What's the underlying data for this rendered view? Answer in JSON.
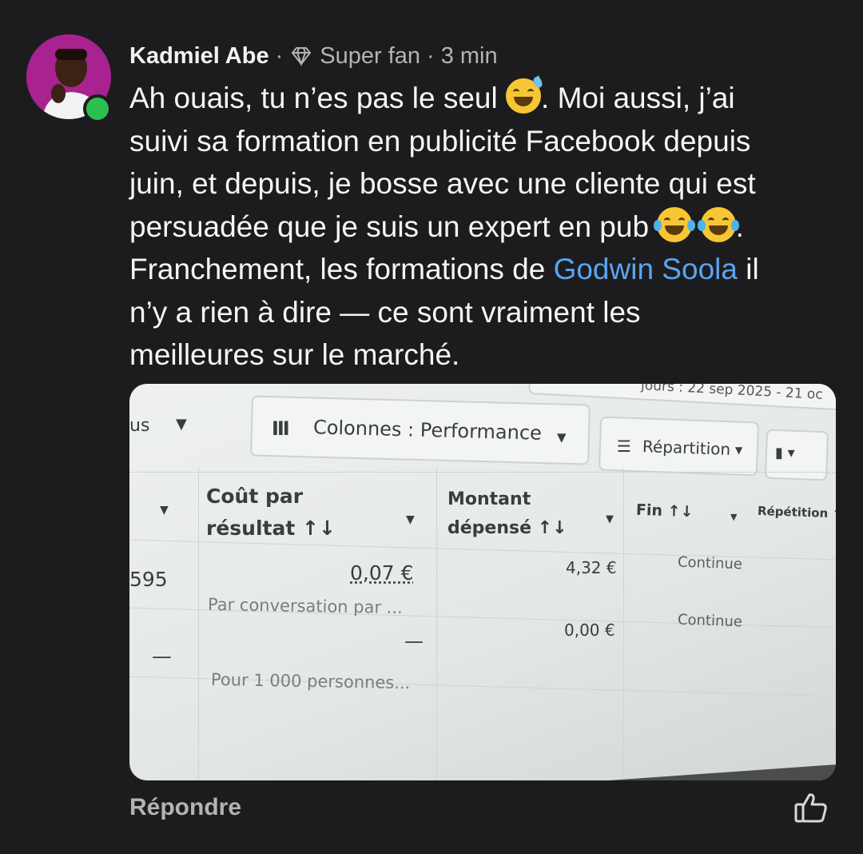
{
  "comment": {
    "author": "Kadmiel Abe",
    "separator1": "·",
    "badge_icon": "diamond-icon",
    "badge": "Super fan",
    "separator2": "·",
    "time": "3 min",
    "line1_a": "Ah ouais, tu n’es pas le seul ",
    "line1_b": ". Moi aussi, j’ai",
    "line2": "suivi sa formation en publicité Facebook depuis",
    "line3": "juin, et depuis, je bosse avec une cliente qui est",
    "line4_a": "persuadée que je suis un expert en pub ",
    "line4_b": ".",
    "line5_a": "Franchement, les formations de ",
    "line5_link": "Godwin Soola",
    "line5_b": " il",
    "line6": "n’y a rien à dire — ce sont vraiment les",
    "line7": "meilleures sur le marché.",
    "reply_label": "Répondre",
    "like_icon": "thumbs-up-icon",
    "online_color": "#2dbf4e",
    "link_color": "#5aa4f0"
  },
  "photo": {
    "date_range": "jours : 22 sep 2025 - 21 oc",
    "left_cut": "us",
    "columns_label": "Colonnes : Performance",
    "breakdown_label": "Répartition",
    "headers": {
      "cost_per_result_1": "Coût par",
      "cost_per_result_2": "résultat ↑↓",
      "amount_spent_1": "Montant",
      "amount_spent_2": "dépensé ↑↓",
      "end": "Fin ↑↓",
      "repetition": "Répétition ↑↓"
    },
    "rows": [
      {
        "left_value": "595",
        "cost": "0,07 €",
        "cost_sub": "Par conversation par ...",
        "spent": "4,32 €",
        "end": "Continue"
      },
      {
        "left_value": "—",
        "cost": "—",
        "cost_sub": "Pour 1 000 personnes...",
        "spent": "0,00 €",
        "end": "Continue"
      }
    ]
  }
}
